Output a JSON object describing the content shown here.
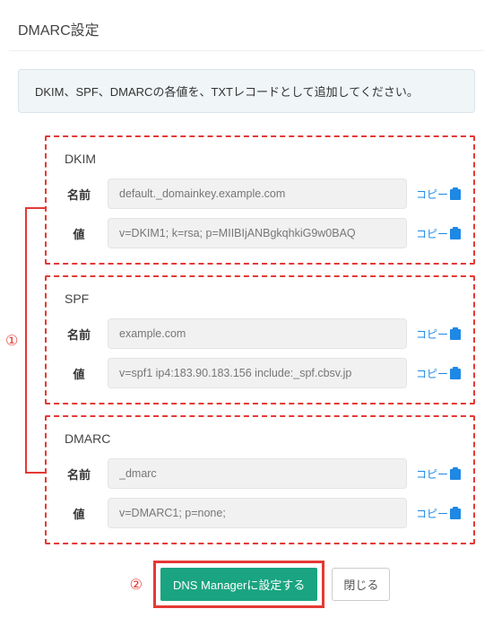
{
  "page_title": "DMARC設定",
  "info_message": "DKIM、SPF、DMARCの各値を、TXTレコードとして追加してください。",
  "annotations": {
    "one": "①",
    "two": "②"
  },
  "copy_label": "コピー",
  "labels": {
    "name": "名前",
    "value": "値"
  },
  "sections": {
    "dkim": {
      "title": "DKIM",
      "name": "default._domainkey.example.com",
      "value": "v=DKIM1; k=rsa; p=MIIBIjANBgkqhkiG9w0BAQ"
    },
    "spf": {
      "title": "SPF",
      "name": "example.com",
      "value": "v=spf1 ip4:183.90.183.156 include:_spf.cbsv.jp"
    },
    "dmarc": {
      "title": "DMARC",
      "name": "_dmarc",
      "value": "v=DMARC1; p=none;"
    }
  },
  "buttons": {
    "primary": "DNS Managerに設定する",
    "close": "閉じる"
  }
}
